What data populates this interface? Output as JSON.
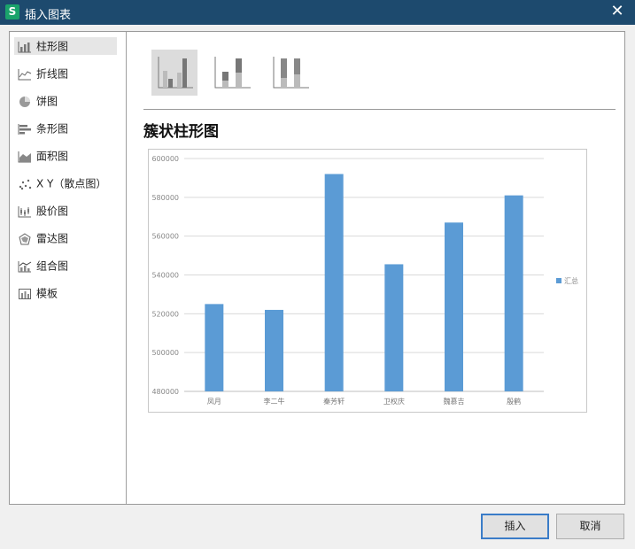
{
  "window": {
    "app_icon": "S",
    "title": "插入图表"
  },
  "sidebar": {
    "items": [
      {
        "label": "柱形图",
        "icon": "column-chart-icon"
      },
      {
        "label": "折线图",
        "icon": "line-chart-icon"
      },
      {
        "label": "饼图",
        "icon": "pie-chart-icon"
      },
      {
        "label": "条形图",
        "icon": "bar-chart-icon"
      },
      {
        "label": "面积图",
        "icon": "area-chart-icon"
      },
      {
        "label": "X Y（散点图）",
        "icon": "scatter-chart-icon"
      },
      {
        "label": "股价图",
        "icon": "stock-chart-icon"
      },
      {
        "label": "雷达图",
        "icon": "radar-chart-icon"
      },
      {
        "label": "组合图",
        "icon": "combo-chart-icon"
      },
      {
        "label": "模板",
        "icon": "template-icon"
      }
    ],
    "selected": "柱形图"
  },
  "variants": [
    {
      "name": "clustered-column-icon"
    },
    {
      "name": "stacked-column-icon"
    },
    {
      "name": "percent-stacked-column-icon"
    }
  ],
  "chart_title": "簇状柱形图",
  "buttons": {
    "insert": "插入",
    "cancel": "取消"
  },
  "chart_data": {
    "type": "bar",
    "categories": [
      "凤月",
      "李二牛",
      "秦芳轩",
      "卫权庆",
      "魏慕吉",
      "殷鹤"
    ],
    "series": [
      {
        "name": "汇总",
        "values": [
          525000,
          522000,
          592000,
          545500,
          567000,
          581000
        ],
        "color": "#5b9bd5"
      }
    ],
    "ylim": [
      480000,
      600000
    ],
    "yticks": [
      "480000",
      "500000",
      "520000",
      "540000",
      "560000",
      "580000",
      "600000"
    ],
    "grid": true,
    "legend": "right"
  }
}
